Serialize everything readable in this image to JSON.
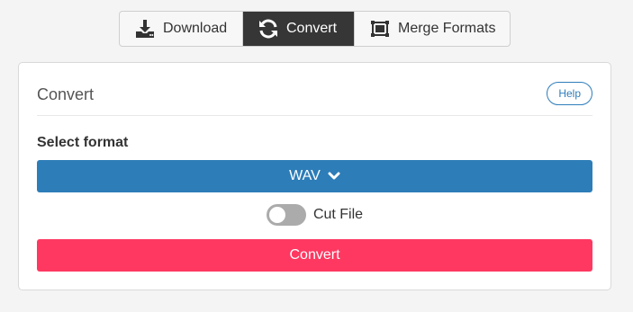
{
  "tabs": [
    {
      "label": "Download",
      "icon": "download-icon",
      "active": false
    },
    {
      "label": "Convert",
      "icon": "refresh-icon",
      "active": true
    },
    {
      "label": "Merge Formats",
      "icon": "merge-icon",
      "active": false
    }
  ],
  "card": {
    "title": "Convert",
    "help_label": "Help",
    "select_label": "Select format",
    "format_value": "WAV",
    "cut_file_label": "Cut File",
    "cut_file_enabled": false,
    "convert_label": "Convert"
  },
  "colors": {
    "active_tab": "#363636",
    "select_bg": "#2d7db8",
    "convert_bg": "#fe3861",
    "help_border": "#2e7dba"
  }
}
